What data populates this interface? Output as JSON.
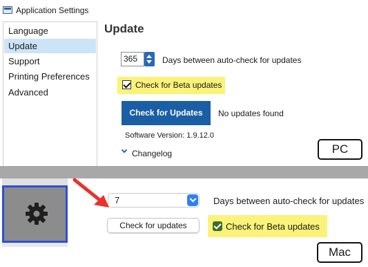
{
  "pc": {
    "window_title": "Application Settings",
    "sidebar": {
      "items": [
        {
          "label": "Language",
          "selected": false
        },
        {
          "label": "Update",
          "selected": true
        },
        {
          "label": "Support",
          "selected": false
        },
        {
          "label": "Printing Preferences",
          "selected": false
        },
        {
          "label": "Advanced",
          "selected": false
        }
      ]
    },
    "page_title": "Update",
    "days_value": "365",
    "days_label": "Days between auto-check for updates",
    "beta_label": "Check for Beta updates",
    "beta_checked": true,
    "check_button": "Check for Updates",
    "status_text": "No updates found",
    "version_text": "Software Version: 1.9.12.0",
    "changelog_label": "Changelog",
    "badge": "PC"
  },
  "mac": {
    "days_value": "7",
    "days_label": "Days between auto-check for updates",
    "check_button": "Check for updates",
    "beta_label": "Check for Beta updates",
    "beta_checked": true,
    "badge": "Mac",
    "icon": "gear-icon"
  },
  "colors": {
    "highlight": "#fbf27a",
    "pc_accent": "#1a5ea5",
    "mac_accent": "#2f7ff5",
    "mac_selection_border": "#2b50d6",
    "arrow": "#e8322e"
  }
}
